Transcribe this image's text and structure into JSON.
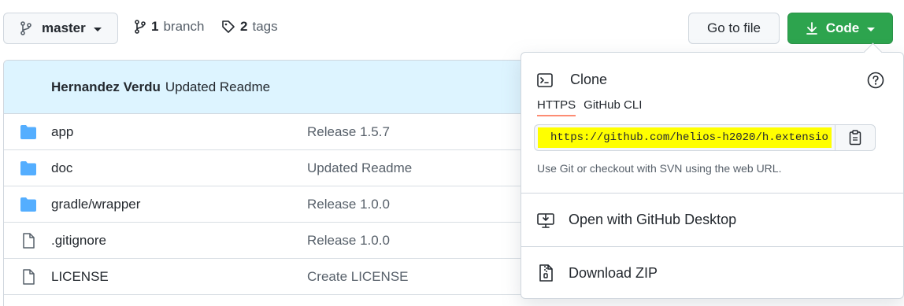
{
  "toolbar": {
    "branch_label": "master",
    "branch_count": "1",
    "branch_word": "branch",
    "tag_count": "2",
    "tag_word": "tags",
    "goto_label": "Go to file",
    "code_label": "Code"
  },
  "commit": {
    "author": "Hernandez Verdu",
    "message": "Updated Readme"
  },
  "files": [
    {
      "type": "folder",
      "name": "app",
      "message": "Release 1.5.7"
    },
    {
      "type": "folder",
      "name": "doc",
      "message": "Updated Readme"
    },
    {
      "type": "folder",
      "name": "gradle/wrapper",
      "message": "Release 1.0.0"
    },
    {
      "type": "file",
      "name": ".gitignore",
      "message": "Release 1.0.0"
    },
    {
      "type": "file",
      "name": "LICENSE",
      "message": "Create LICENSE"
    }
  ],
  "clone_popover": {
    "title": "Clone",
    "tabs": [
      "HTTPS",
      "GitHub CLI"
    ],
    "active_tab": "HTTPS",
    "url": "https://github.com/helios-h2020/h.extensio",
    "hint": "Use Git or checkout with SVN using the web URL.",
    "open_desktop_label": "Open with GitHub Desktop",
    "download_zip_label": "Download ZIP"
  },
  "colors": {
    "code_button": "#2da44e",
    "commit_bar": "#ddf4ff",
    "folder_icon": "#54aeff",
    "url_highlight": "#ffff00",
    "active_tab_underline": "#fd8c73"
  }
}
